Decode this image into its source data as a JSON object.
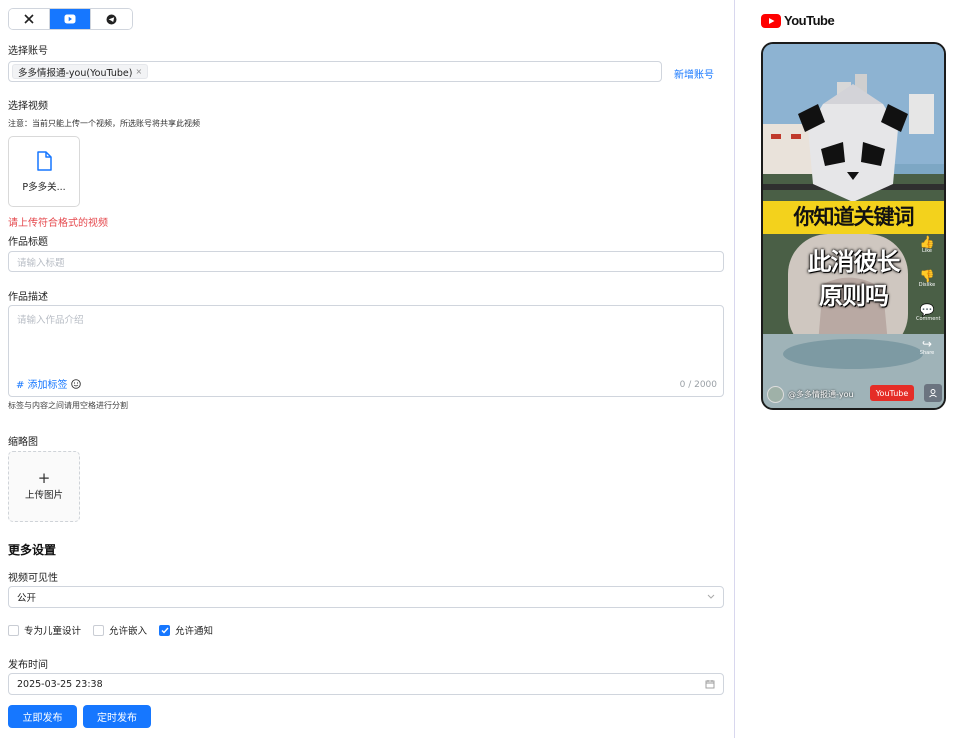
{
  "tabs": [
    {
      "icon": "x-logo-icon",
      "active": false
    },
    {
      "icon": "youtube-icon",
      "active": true
    },
    {
      "icon": "telegram-icon",
      "active": false
    }
  ],
  "account": {
    "label": "选择账号",
    "selected": "多多情报通-you(YouTube)",
    "remove_glyph": "×",
    "add_label": "新增账号"
  },
  "video": {
    "label": "选择视频",
    "note": "注意：当前只能上传一个视频，所选账号将共享此视频",
    "file_name": "P多多关...",
    "error": "请上传符合格式的视频"
  },
  "title_field": {
    "label": "作品标题",
    "placeholder": "请输入标题"
  },
  "description": {
    "label": "作品描述",
    "placeholder": "请输入作品介绍",
    "add_tag": "# 添加标签",
    "counter": "0 / 2000",
    "hint": "标签与内容之间请用空格进行分割"
  },
  "thumbnail": {
    "label": "缩略图",
    "plus": "+",
    "upload": "上传图片"
  },
  "more": {
    "title": "更多设置",
    "visibility_label": "视频可见性",
    "visibility_value": "公开",
    "checks": [
      {
        "label": "专为儿童设计",
        "checked": false
      },
      {
        "label": "允许嵌入",
        "checked": false
      },
      {
        "label": "允许通知",
        "checked": true
      }
    ],
    "publish_time_label": "发布时间",
    "publish_time_value": "2025-03-25 23:38"
  },
  "buttons": {
    "publish_now": "立即发布",
    "schedule": "定时发布"
  },
  "preview": {
    "brand": "YouTube",
    "caption_line1": "你知道关键词",
    "caption_line2": "此消彼长",
    "caption_line3": "原则吗",
    "channel": "@多多情报通-you",
    "subscribe": "YouTube",
    "side": [
      {
        "icon": "thumbs-up-icon",
        "label": "Like"
      },
      {
        "icon": "thumbs-down-icon",
        "label": "Dislike"
      },
      {
        "icon": "comment-icon",
        "label": "Comment"
      },
      {
        "icon": "share-icon",
        "label": "Share"
      }
    ]
  },
  "colors": {
    "primary": "#1677ff",
    "error": "#e5484d",
    "youtube_red": "#e52d27",
    "caption_yellow": "#f3d21c"
  }
}
